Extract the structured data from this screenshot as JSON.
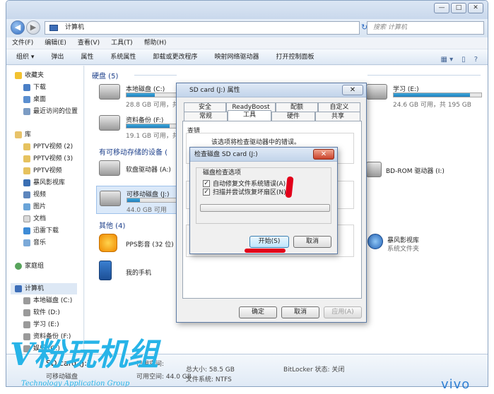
{
  "window": {
    "address": "计算机",
    "search_placeholder": "搜索 计算机",
    "controls": [
      "—",
      "□",
      "✕"
    ]
  },
  "menu": [
    "文件(F)",
    "编辑(E)",
    "查看(V)",
    "工具(T)",
    "帮助(H)"
  ],
  "toolbar": [
    "组织 ▾",
    "弹出",
    "属性",
    "系统属性",
    "卸载或更改程序",
    "映射网络驱动器",
    "打开控制面板"
  ],
  "nav": {
    "favorites": [
      "收藏夹",
      "下载",
      "桌面",
      "最近访问的位置"
    ],
    "library": [
      "库",
      "PPTV视频 (2)",
      "PPTV视频 (3)",
      "PPTV视频",
      "暴风影视库",
      "视频",
      "图片",
      "文档",
      "迅雷下载",
      "音乐"
    ],
    "homegroup": "家庭组",
    "computer": [
      "计算机",
      "本地磁盘 (C:)",
      "软件 (D:)",
      "学习 (E:)",
      "资料备份 (F:)",
      "娱乐 (G:)",
      "SD card (J:)"
    ]
  },
  "groups": {
    "hdd": "硬盘 (5)",
    "removable": "有可移动存储的设备 (",
    "other": "其他 (4)"
  },
  "drives": {
    "c": {
      "name": "本地磁盘 (C:)",
      "free": "28.8 GB 可用，共 59.9 GB",
      "used": 0.52
    },
    "f": {
      "name": "资料备份 (F:)",
      "free": "19.1 GB 可用，共",
      "used": 0.8
    },
    "e": {
      "name": "学习 (E:)",
      "free": "24.6 GB 可用，共 195 GB",
      "used": 0.87
    },
    "floppy": {
      "name": "软盘驱动器 (A:)"
    },
    "bd": {
      "name": "BD-ROM 驱动器 (I:)"
    },
    "sd": {
      "name": "可移动磁盘 (J:)",
      "free": "44.0 GB 可用",
      "used": 0.25
    },
    "pps": {
      "name": "PPS影音 (32 位)"
    },
    "phone": {
      "name": "我的手机"
    },
    "baofeng": {
      "name": "暴风影视库",
      "sub": "系统文件夹"
    }
  },
  "details": {
    "name": "SD card (J:)",
    "type": "可移动磁盘",
    "used_label": "已用空间:",
    "free_label": "可用空间: 44.0 GB",
    "total": "总大小: 58.5 GB",
    "fs": "文件系统: NTFS",
    "bitlocker": "BitLocker 状态: 关闭"
  },
  "props": {
    "title": "SD card (J:) 属性",
    "tabs_row1": [
      "安全",
      "ReadyBoost",
      "配额",
      "自定义"
    ],
    "tabs_row2": [
      "常规",
      "工具",
      "硬件",
      "共享"
    ],
    "section": "查错",
    "desc": "该选项将检查驱动器中的错误。",
    "ok": "确定",
    "cancel": "取消",
    "apply": "应用(A)"
  },
  "check": {
    "title": "检查磁盘 SD card (J:)",
    "group": "磁盘检查选项",
    "opt1": "自动修复文件系统错误(A)",
    "opt2": "扫描并尝试恢复坏扇区(N)",
    "start": "开始(S)",
    "cancel": "取消"
  },
  "watermark": {
    "brand": "vivo",
    "main": "V粉玩机组",
    "sub": "Technology Application Group"
  }
}
